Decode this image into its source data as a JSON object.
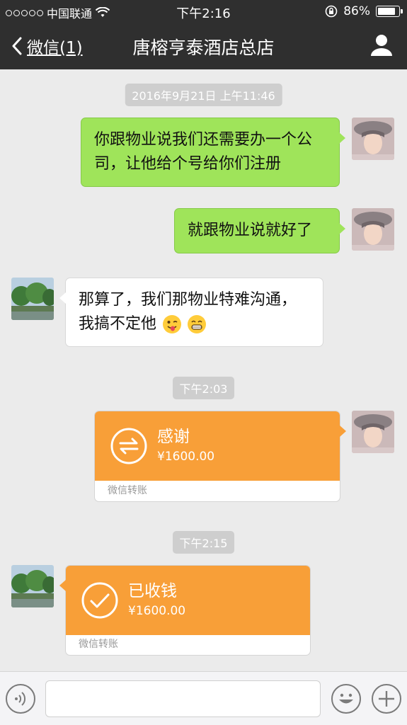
{
  "status_bar": {
    "carrier": "中国联通",
    "time": "下午2:16",
    "battery": "86%",
    "battery_level": 0.86
  },
  "nav": {
    "back_label": "微信(1)",
    "title": "唐榕亨泰酒店总店"
  },
  "messages": {
    "timestamp_1": "2016年9月21日 上午11:46",
    "msg_1": "你跟物业说我们还需要办一个公司，让他给个号给你们注册",
    "msg_2": "就跟物业说就好了",
    "msg_3": "那算了，我们那物业特难沟通，我搞不定他",
    "timestamp_2": "下午2:03",
    "transfer_1": {
      "title": "感谢",
      "amount": "¥1600.00",
      "footer": "微信转账"
    },
    "timestamp_3": "下午2:15",
    "transfer_2": {
      "title": "已收钱",
      "amount": "¥1600.00",
      "footer": "微信转账"
    }
  },
  "icons": {
    "back": "chevron-left-icon",
    "user": "user-icon",
    "voice": "voice-icon",
    "emoji": "emoji-icon",
    "add": "plus-icon",
    "transfer": "transfer-arrows-icon",
    "received": "checkmark-icon"
  },
  "colors": {
    "header_bg": "#2f2f2f",
    "chat_bg": "#ebebeb",
    "bubble_green": "#9fe45a",
    "transfer_orange": "#f89f38"
  }
}
